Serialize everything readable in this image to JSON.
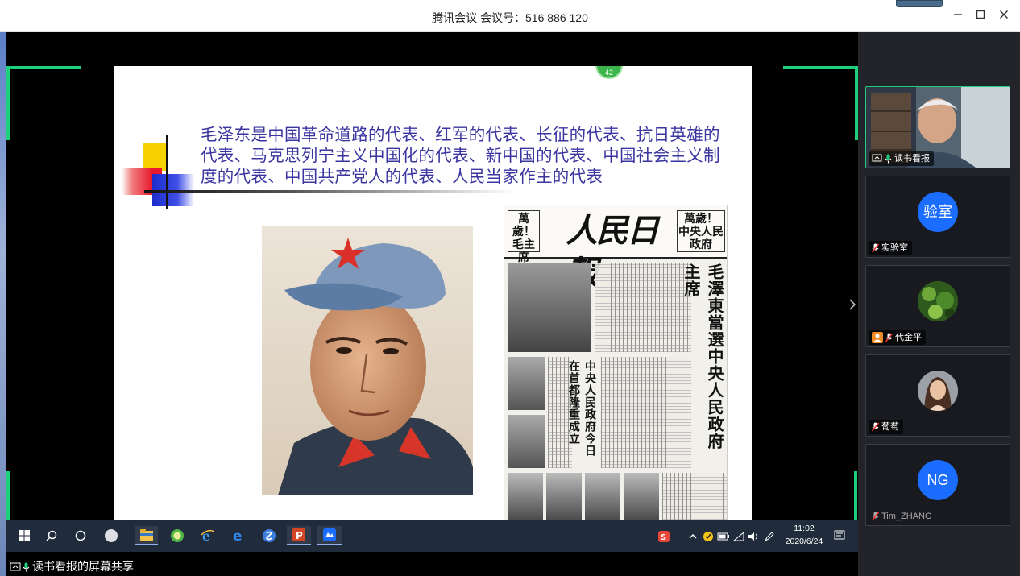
{
  "window": {
    "title": "腾讯会议 会议号：516 886 120",
    "minimize_icon": "minimize-icon",
    "maximize_icon": "maximize-icon",
    "close_icon": "close-icon"
  },
  "slide": {
    "page_badge": "42",
    "heading": "毛泽东是中国革命道路的代表、红军的代表、长征的代表、抗日英雄的代表、马克思列宁主义中国化的代表、新中国的代表、中国社会主义制度的代表、中国共产党人的代表、人民当家作主的代表",
    "portrait_alt": "portrait-photo",
    "newspaper": {
      "masthead": "人民日報",
      "left_box": "萬歲！ 毛主席",
      "right_box": "萬歲！ 中央人民政府",
      "headline": "毛澤東當選中央人民政府主席",
      "subheadline": "中央人民政府今日在首都隆重成立"
    }
  },
  "taskbar": {
    "icons": [
      "windows-start-icon",
      "search-icon",
      "cortana-icon",
      "pinwheel-icon",
      "file-explorer-icon",
      "browser-360-icon",
      "ie-icon",
      "edge-icon",
      "sogou-icon",
      "powerpoint-icon",
      "tencent-meeting-icon"
    ],
    "tray_icons": [
      "sogou-ime-icon",
      "chevron-up-icon",
      "norton-icon",
      "battery-icon",
      "network-icon",
      "volume-icon",
      "pen-icon"
    ],
    "time": "11:02",
    "date": "2020/6/24",
    "notification_icon": "notification-icon"
  },
  "share_caption": "读书看报的屏幕共享",
  "participants": [
    {
      "name": "读书看报",
      "avatar_text": "",
      "video": true,
      "sharing": true,
      "mic_on": true
    },
    {
      "name": "实验室",
      "avatar_text": "验室",
      "video": false,
      "sharing": false,
      "mic_on": false
    },
    {
      "name": "代金平",
      "avatar_text": "",
      "video": false,
      "sharing": false,
      "mic_on": false,
      "has_photo_avatar": true
    },
    {
      "name": "葡萄",
      "avatar_text": "",
      "video": false,
      "sharing": false,
      "mic_on": false,
      "has_photo_avatar": true
    },
    {
      "name": "Tim_ZHANG",
      "avatar_text": "NG",
      "video": false,
      "sharing": false,
      "mic_on": false
    }
  ],
  "colors": {
    "accent_green": "#1ed07c",
    "avatar_blue": "#1a6dff",
    "heading_purple": "#3b35a0",
    "taskbar_bg": "#202b3c"
  }
}
